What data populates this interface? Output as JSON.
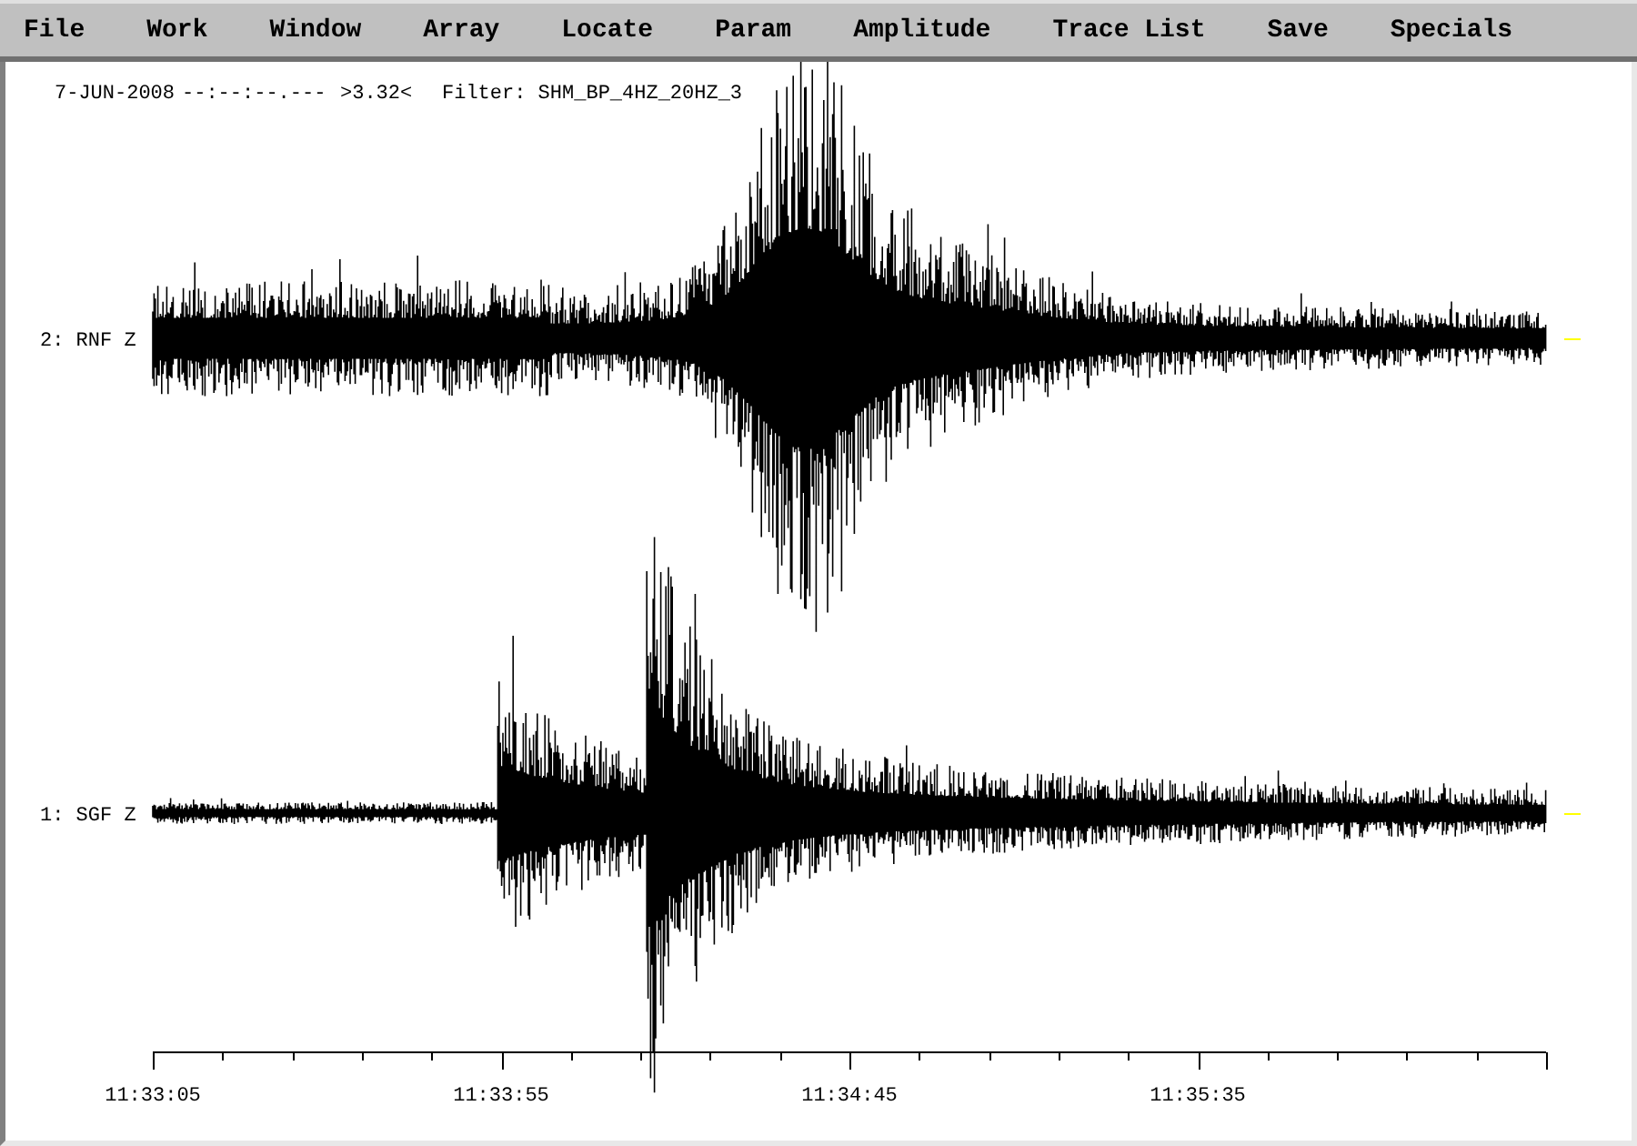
{
  "menu": [
    "File",
    "Work",
    "Window",
    "Array",
    "Locate",
    "Param",
    "Amplitude",
    "Trace List",
    "Save",
    "Specials"
  ],
  "header": {
    "date": "7-JUN-2008",
    "time": "--:--:--.---",
    "amplitude": ">3.32<",
    "filter": "Filter: SHM_BP_4HZ_20HZ_3"
  },
  "traces": [
    {
      "label": "2: RNF Z"
    },
    {
      "label": "1: SGF Z"
    }
  ],
  "time_axis": {
    "labels": [
      "11:33:05",
      "11:33:55",
      "11:34:45",
      "11:35:35"
    ]
  }
}
